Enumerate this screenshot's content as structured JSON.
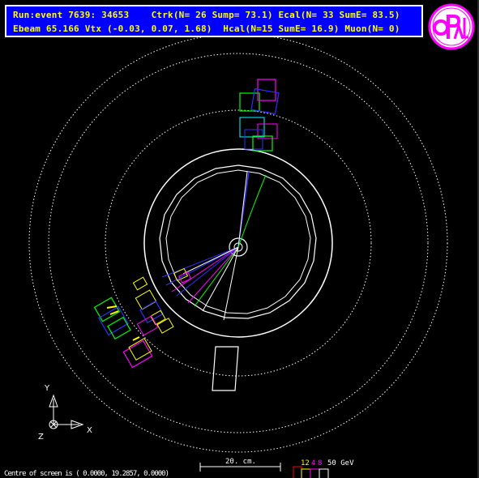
{
  "header": {
    "line1": "Run:event 7639: 34653    Ctrk(N= 26 Sump= 73.1) Ecal(N= 33 SumE= 83.5)",
    "line2": "Ebeam 65.166 Vtx (-0.03, 0.07, 1.68)  Hcal(N=15 SumE= 16.9) Muon(N= 0)"
  },
  "logo": {
    "text": "OPAL",
    "ring_color": "#ff00ff",
    "fill": "#ffffff"
  },
  "axes": {
    "y": "Y",
    "x": "X",
    "z": "Z"
  },
  "footer": {
    "centre": "Centre of screen is (   0.0000,  19.2857,   0.0000)",
    "scale": "20. cm.",
    "energy_scale": {
      "a": "12",
      "b": "4",
      "c": "8",
      "unit": "50 GeV"
    }
  },
  "colors": {
    "background": "#000000",
    "header_bg": "#0000ff",
    "header_text": "#ffff00",
    "detector": "#ffffff",
    "track_blue": "#3030ff",
    "track_green": "#00ff00",
    "track_magenta": "#ff00ff",
    "track_yellow": "#ffff00"
  }
}
